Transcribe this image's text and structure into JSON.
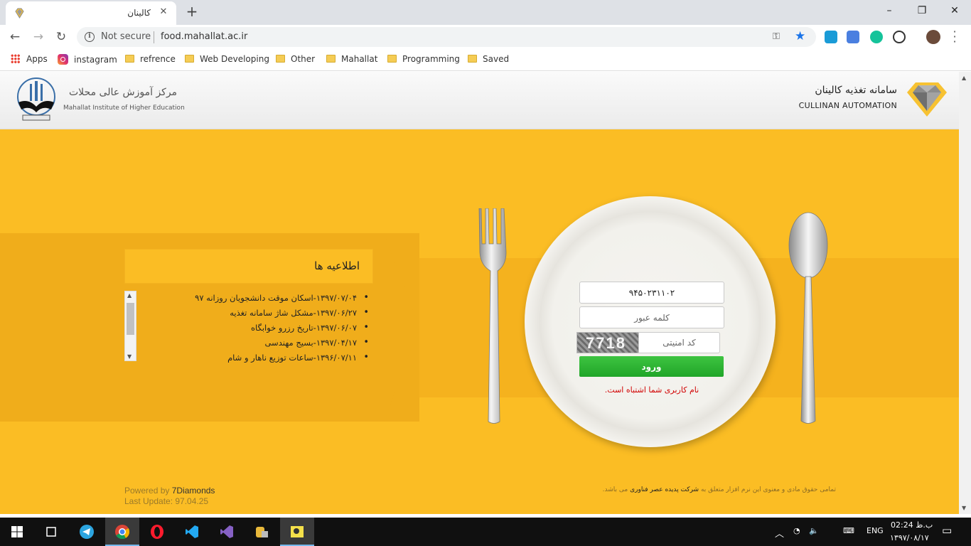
{
  "browser": {
    "tab_title": "کالینان",
    "tab_close": "✕",
    "new_tab": "+",
    "window_controls": [
      "–",
      "❐",
      "✕"
    ],
    "security_label": "Not secure",
    "url": "food.mahallat.ac.ir",
    "bookmarks": [
      "Apps",
      "instagram",
      "refrence",
      "Web Developing",
      "Other",
      "Mahallat",
      "Programming",
      "Saved"
    ]
  },
  "header": {
    "university_name_fa": "مرکز آموزش عالی محلات",
    "university_name_en": "Mahallat Institute of Higher Education",
    "system_name_fa": "سامانه تغذیه کالینان",
    "system_name_en": "CULLINAN AUTOMATION"
  },
  "news": {
    "title": "اطلاعیه ها",
    "items": [
      "۱۳۹۷/۰۷/۰۴-اسکان موقت دانشجویان روزانه ۹۷",
      "۱۳۹۷/۰۶/۲۷-مشکل شاژ سامانه تغذیه",
      "۱۳۹۷/۰۶/۰۷-تاریخ رزرو خوابگاه",
      "۱۳۹۷/۰۴/۱۷-بسیج مهندسی",
      "۱۳۹۶/۰۷/۱۱-ساعات توزیع ناهار و شام"
    ]
  },
  "login": {
    "username_value": "۹۴۵۰۲۳۱۱۰۲",
    "password_placeholder": "کلمه عبور",
    "captcha_code": "7718",
    "captcha_placeholder": "کد امنیتی",
    "submit_label": "ورود",
    "error_message": "نام کاربری شما اشتباه است."
  },
  "footer": {
    "powered_prefix": "Powered by",
    "powered_brand": "7Diamonds",
    "last_update": "Last Update: 97.04.25",
    "copyright_pre": "تمامی حقوق مادی و معنوی این نرم افزار متعلق به",
    "copyright_company": "شرکت پدیده عصر فناوری",
    "copyright_post": "می باشد."
  },
  "taskbar": {
    "language": "ENG",
    "time": "ب.ظ 02:24",
    "date": "۱۳۹۷/۰۸/۱۷"
  },
  "colors": {
    "page_background": "#fbbd24",
    "login_button": "#29b22f",
    "error_text": "#d10000"
  }
}
